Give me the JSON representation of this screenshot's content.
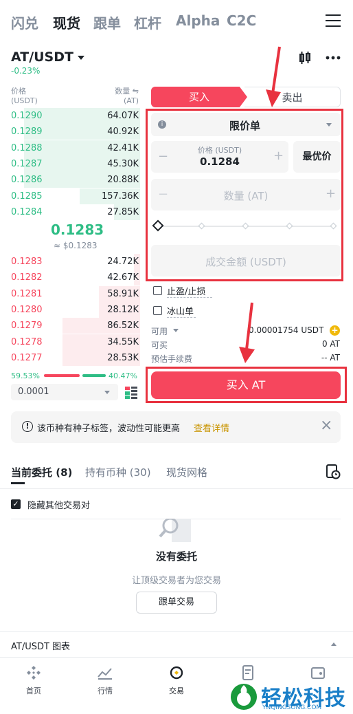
{
  "top_tabs": [
    "闪兑",
    "现货",
    "跟单",
    "杠杆",
    "Alpha",
    "C2C"
  ],
  "pair": {
    "name": "AT/USDT",
    "change": "-0.23%"
  },
  "orderbook": {
    "price_header": "价格",
    "price_unit": "(USDT)",
    "qty_header": "数量 ⇋",
    "qty_unit": "(AT)",
    "bids": [
      {
        "price": "0.1290",
        "qty": "64.07K",
        "depth": 0.9
      },
      {
        "price": "0.1289",
        "qty": "40.92K",
        "depth": 0.9
      },
      {
        "price": "0.1288",
        "qty": "42.41K",
        "depth": 0.9
      },
      {
        "price": "0.1287",
        "qty": "45.30K",
        "depth": 0.9
      },
      {
        "price": "0.1286",
        "qty": "20.88K",
        "depth": 0.9
      },
      {
        "price": "0.1285",
        "qty": "157.36K",
        "depth": 0.47
      },
      {
        "price": "0.1284",
        "qty": "27.85K",
        "depth": 0.2
      }
    ],
    "mid_price": "0.1283",
    "mid_fiat": "≈ $0.1283",
    "asks": [
      {
        "price": "0.1283",
        "qty": "24.72K",
        "depth": 0.05
      },
      {
        "price": "0.1282",
        "qty": "42.67K",
        "depth": 0.05
      },
      {
        "price": "0.1281",
        "qty": "58.91K",
        "depth": 0.32
      },
      {
        "price": "0.1280",
        "qty": "28.12K",
        "depth": 0.32
      },
      {
        "price": "0.1279",
        "qty": "86.52K",
        "depth": 0.6
      },
      {
        "price": "0.1278",
        "qty": "34.55K",
        "depth": 0.6
      },
      {
        "price": "0.1277",
        "qty": "28.53K",
        "depth": 0.6
      }
    ],
    "buy_ratio": "59.53%",
    "sell_ratio": "40.47%",
    "buy_ratio_value": 59.53,
    "precision": "0.0001"
  },
  "form": {
    "buy_tab": "买入",
    "sell_tab": "卖出",
    "order_type": "限价单",
    "price_label": "价格 (USDT)",
    "price_value": "0.1284",
    "best_price": "最优价",
    "qty_placeholder": "数量 (AT)",
    "amount_placeholder": "成交金额 (USDT)",
    "tp_sl": "止盈/止损",
    "iceberg": "冰山单",
    "available_label": "可用",
    "available_value": "0.00001754 USDT",
    "can_buy_label": "可买",
    "can_buy_value": "0 AT",
    "fee_label": "预估手续费",
    "fee_value": "-- AT",
    "buy_button": "买入 AT"
  },
  "notice": {
    "text": "该币种有种子标签，波动性可能更高",
    "link": "查看详情"
  },
  "bottom_tabs": {
    "open_orders": "当前委托 (8)",
    "holdings": "持有币种 (30)",
    "grid": "现货网格"
  },
  "hide_other_pairs": "隐藏其他交易对",
  "empty": {
    "title": "没有委托",
    "subtitle": "让顶级交易者为您交易",
    "button": "跟单交易"
  },
  "chart_bar": "AT/USDT 图表",
  "bottom_nav": [
    "首页",
    "行情",
    "交易"
  ],
  "watermark": {
    "name": "轻松科技",
    "domain": "YNQINGSONG.COM"
  },
  "colors": {
    "buy": "#2ebd85",
    "sell": "#f6465d",
    "accent_red": "#e8323f"
  }
}
